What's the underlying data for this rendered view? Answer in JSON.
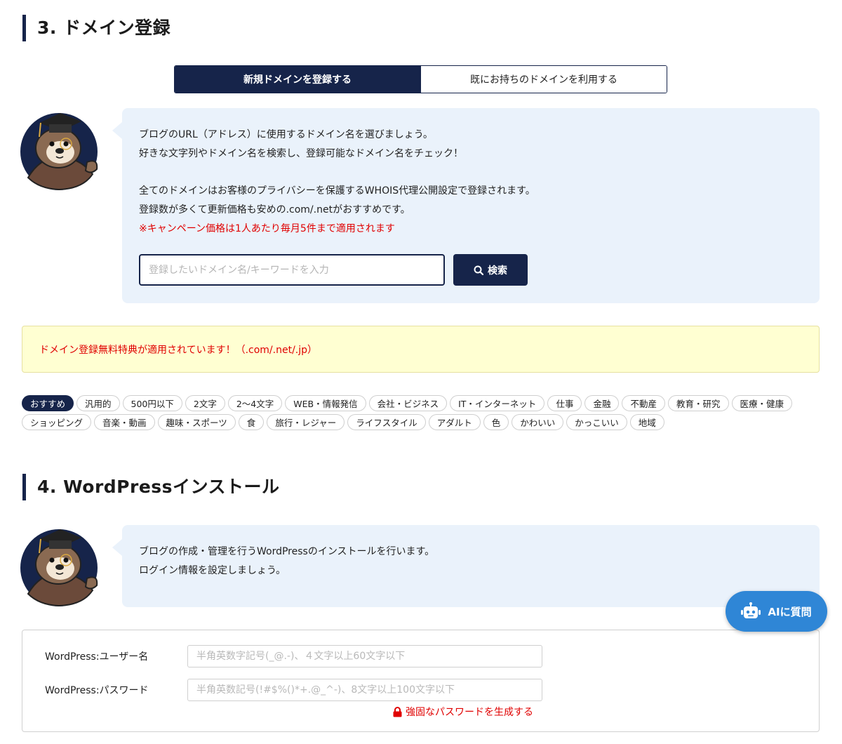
{
  "domain_section": {
    "title": "3. ドメイン登録",
    "tabs": [
      {
        "label": "新規ドメインを登録する",
        "active": true
      },
      {
        "label": "既にお持ちのドメインを利用する",
        "active": false
      }
    ],
    "bubble_lines": [
      "ブログのURL（アドレス）に使用するドメイン名を選びましょう。",
      "好きな文字列やドメイン名を検索し、登録可能なドメイン名をチェック！",
      "全てのドメインはお客様のプライバシーを保護するWHOIS代理公開設定で登録されます。",
      "登録数が多くて更新価格も安めの.com/.netがおすすめです。"
    ],
    "campaign_note": "※キャンペーン価格は1人あたり毎月5件まで適用されます",
    "search": {
      "placeholder": "登録したいドメイン名/キーワードを入力",
      "value": "",
      "button_label": "検索",
      "button_icon": "search-icon"
    },
    "notice": "ドメイン登録無料特典が適用されています！（.com/.net/.jp）",
    "categories": [
      "おすすめ",
      "汎用的",
      "500円以下",
      "2文字",
      "2〜4文字",
      "WEB・情報発信",
      "会社・ビジネス",
      "IT・インターネット",
      "仕事",
      "金融",
      "不動産",
      "教育・研究",
      "医療・健康",
      "ショッピング",
      "音楽・動画",
      "趣味・スポーツ",
      "食",
      "旅行・レジャー",
      "ライフスタイル",
      "アダルト",
      "色",
      "かわいい",
      "かっこいい",
      "地域"
    ],
    "active_category": "おすすめ"
  },
  "wp_section": {
    "title": "4. WordPressインストール",
    "bubble_lines": [
      "ブログの作成・管理を行うWordPressのインストールを行います。",
      "ログイン情報を設定しましょう。"
    ],
    "username": {
      "label": "WordPress:ユーザー名",
      "placeholder": "半角英数字記号(_@.-)、４文字以上60文字以下",
      "value": ""
    },
    "password": {
      "label": "WordPress:パスワード",
      "placeholder": "半角英数記号(!#$%()*+.@_^-)、8文字以上100文字以下",
      "value": ""
    },
    "generate_link": "強固なパスワードを生成する",
    "generate_icon": "lock-icon"
  },
  "ai_button": {
    "label": "AIに質問",
    "icon": "robot-icon"
  },
  "colors": {
    "navy": "#16244a",
    "bubble": "#eaf2fb",
    "notice_bg": "#ffffd2",
    "red": "#e00000",
    "ai_blue": "#2f86d6"
  }
}
